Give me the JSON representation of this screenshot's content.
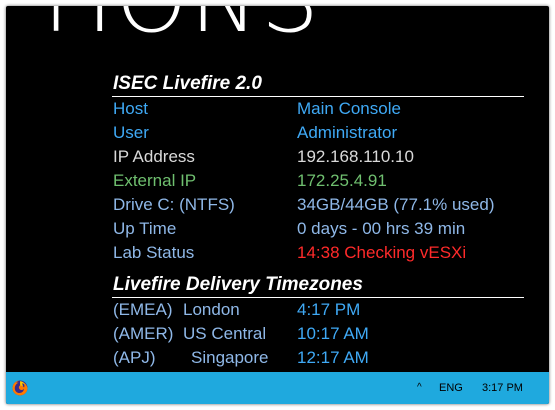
{
  "wallpaper": {
    "text": "TIONS"
  },
  "colors": {
    "background": "#000000",
    "blue_label": "#3fa9f5",
    "gray_label": "#d9d9d9",
    "green": "#6fbf6f",
    "drive": "#8fb8e8",
    "alert": "#ff2a2a",
    "taskbar": "#1fa9de"
  },
  "bginfo": {
    "title": "ISEC Livefire 2.0",
    "rows": [
      {
        "label": "Host",
        "value": "Main Console"
      },
      {
        "label": "User",
        "value": "Administrator"
      },
      {
        "label": "IP Address",
        "value": "192.168.110.10"
      },
      {
        "label": "External IP",
        "value": "172.25.4.91"
      },
      {
        "label": "Drive C: (NTFS)",
        "value": "34GB/44GB (77.1% used)"
      },
      {
        "label": "Up Time",
        "value": "0 days - 00 hrs 39 min"
      },
      {
        "label": "Lab Status",
        "value": "14:38 Checking vESXi"
      }
    ],
    "timezones_title": "Livefire Delivery Timezones",
    "timezones": [
      {
        "region": "(EMEA)",
        "city": "London",
        "time": "4:17 PM"
      },
      {
        "region": "(AMER)",
        "city": "US Central",
        "time": "10:17 AM"
      },
      {
        "region": "(APJ)",
        "city": "Singapore",
        "time": "12:17 AM"
      }
    ]
  },
  "taskbar": {
    "app_icon": "firefox-icon",
    "tray_chevron": "^",
    "language": "ENG",
    "clock": "3:17 PM"
  }
}
